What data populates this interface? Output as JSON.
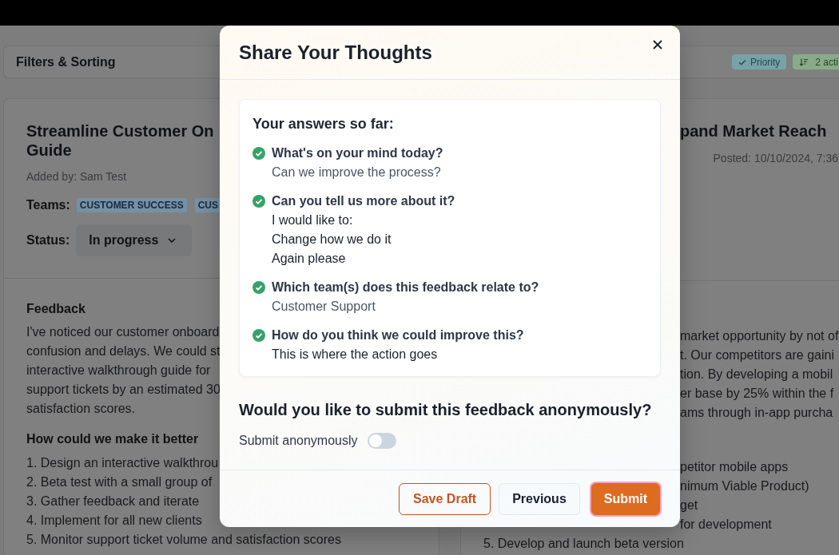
{
  "filters_bar": {
    "title": "Filters & Sorting",
    "chips": [
      {
        "kind": "check",
        "label": "Priority",
        "color": "#77a3a8"
      },
      {
        "kind": "sort",
        "label": "2 acti",
        "color": "#89ab89"
      }
    ]
  },
  "cards": [
    {
      "title_lines": [
        "Streamline Customer On",
        "Guide"
      ],
      "added_by": "Added by: Sam Test",
      "teams_label": "Teams:",
      "teams": [
        "CUSTOMER SUCCESS",
        "CUS"
      ],
      "status_label": "Status:",
      "status": "In progress",
      "feedback_heading": "Feedback",
      "feedback_lines": [
        "I've noticed our customer onboard",
        "confusion and delays. We could st",
        "interactive walkthrough guide for",
        "support tickets by an estimated 30",
        "satisfaction scores."
      ],
      "steps_heading": "How could we make it better",
      "steps": [
        "1. Design an interactive walkthrou",
        "2. Beta test with a small group of",
        "3. Gather feedback and iterate",
        "4. Implement for all new clients",
        "5. Monitor support ticket volume and satisfaction scores"
      ]
    },
    {
      "title_lines": [
        "pand Market Reach"
      ],
      "posted": "Posted: 10/10/2024, 7:36",
      "feedback_lines": [
        "market opportunity by not of",
        "t. Our competitors are gaini",
        "tion. By developing a mobil",
        "er base by 25% within the f",
        "ams through in-app purcha"
      ],
      "steps": [
        "petitor mobile apps",
        "nimum Viable Product)",
        "get",
        "for development",
        "5. Develop and launch beta version"
      ]
    }
  ],
  "dialog": {
    "title": "Share Your Thoughts",
    "summary": {
      "heading": "Your answers so far:",
      "answers": [
        {
          "question": "What's on your mind today?",
          "answer_lines": [
            "Can we improve the process?"
          ],
          "kind": "choice",
          "answered": true
        },
        {
          "question": "Can you tell us more about it?",
          "answer_lines": [
            "I would like to:",
            "Change how we do it",
            "Again please"
          ],
          "kind": "text",
          "answered": true
        },
        {
          "question": "Which team(s) does this feedback relate to?",
          "answer_lines": [
            "Customer Support"
          ],
          "kind": "choice",
          "answered": true
        },
        {
          "question": "How do you think we could improve this?",
          "answer_lines": [
            "This is where the action goes"
          ],
          "kind": "text",
          "answered": true
        }
      ]
    },
    "anonymity": {
      "heading": "Would you like to submit this feedback anonymously?",
      "toggle": {
        "label": "Submit anonymously",
        "on": false
      }
    },
    "buttons": [
      {
        "label": "Save Draft",
        "kind": "outline",
        "focused": false
      },
      {
        "label": "Previous",
        "kind": "secondary",
        "focused": false
      },
      {
        "label": "Submit",
        "kind": "primary",
        "focused": true
      }
    ]
  }
}
